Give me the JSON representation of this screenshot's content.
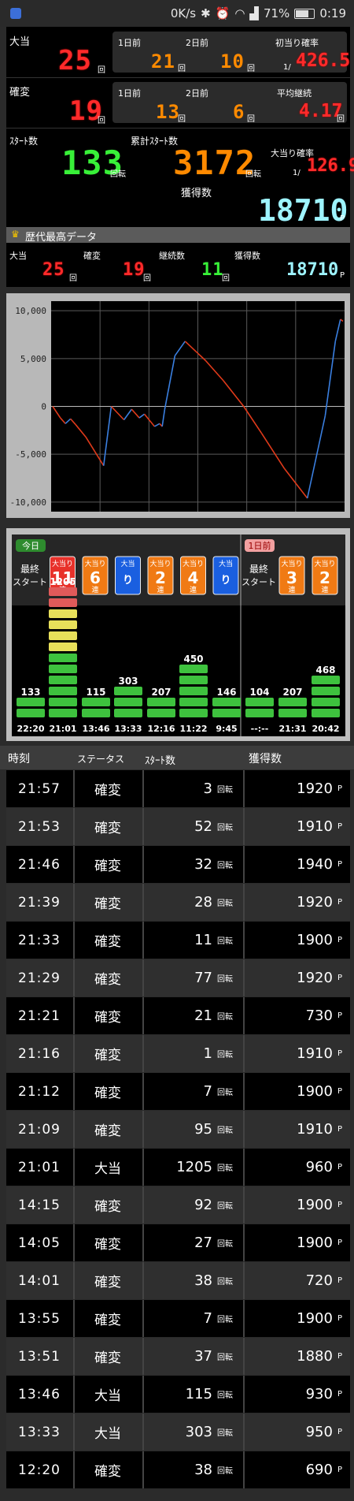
{
  "status": {
    "speed": "0K/s",
    "battery": "71%",
    "time": "0:19"
  },
  "summary": {
    "ootari": {
      "label": "大当",
      "value": "25",
      "unit": "回"
    },
    "prev1": {
      "label": "1日前",
      "value": "21",
      "unit": "回"
    },
    "prev2": {
      "label": "2日前",
      "value": "10",
      "unit": "回"
    },
    "first_prob": {
      "label": "初当り確率",
      "prefix": "1/",
      "value": "426.5"
    },
    "kakuhen": {
      "label": "確変",
      "value": "19",
      "unit": "回"
    },
    "k_prev1": {
      "label": "1日前",
      "value": "13",
      "unit": "回"
    },
    "k_prev2": {
      "label": "2日前",
      "value": "6",
      "unit": "回"
    },
    "avg_cont": {
      "label": "平均継続",
      "value": "4.17",
      "unit": "回"
    },
    "start": {
      "label": "ｽﾀｰﾄ数",
      "value": "133",
      "unit": "回転"
    },
    "total_start": {
      "label": "累計ｽﾀｰﾄ数",
      "value": "3172",
      "unit": "回転"
    },
    "ootari_prob": {
      "label": "大当り確率",
      "prefix": "1/",
      "value": "126.9"
    },
    "gain": {
      "label": "獲得数",
      "value": "18710",
      "unit": "P"
    }
  },
  "best": {
    "title": "歴代最高データ",
    "ootari": {
      "label": "大当",
      "value": "25",
      "unit": "回"
    },
    "kakuhen": {
      "label": "確変",
      "value": "19",
      "unit": "回"
    },
    "keizoku": {
      "label": "継続数",
      "value": "11",
      "unit": "回"
    },
    "gain": {
      "label": "獲得数",
      "value": "18710",
      "unit": "P"
    }
  },
  "chart_data": {
    "type": "line",
    "ylim": [
      -11000,
      11000
    ],
    "yticks": [
      "10,000",
      "5,000",
      "0",
      "-5,000",
      "-10,000"
    ],
    "ytick_values": [
      10000,
      5000,
      0,
      -5000,
      -10000
    ],
    "points": [
      [
        0,
        0
      ],
      [
        3,
        -1200
      ],
      [
        5,
        -1800
      ],
      [
        7,
        -1300
      ],
      [
        9,
        -1900
      ],
      [
        13,
        -3200
      ],
      [
        20,
        -6200
      ],
      [
        23,
        0
      ],
      [
        28,
        -1400
      ],
      [
        31,
        -300
      ],
      [
        34,
        -1200
      ],
      [
        36,
        -800
      ],
      [
        40,
        -2100
      ],
      [
        42,
        -1800
      ],
      [
        43,
        -2100
      ],
      [
        44,
        -300
      ],
      [
        48,
        5300
      ],
      [
        52,
        6800
      ],
      [
        60,
        4800
      ],
      [
        67,
        2700
      ],
      [
        75,
        0
      ],
      [
        82,
        -2800
      ],
      [
        91,
        -6500
      ],
      [
        100,
        -9600
      ],
      [
        107,
        -1000
      ],
      [
        111,
        6800
      ],
      [
        113,
        9100
      ],
      [
        114,
        8900
      ]
    ],
    "up_color": "#3a7fe0",
    "down_color": "#e03a1a",
    "grid": true
  },
  "today_badge": "今日",
  "prev_badge": "1日前",
  "hits_today": [
    {
      "label": "最終\nスタート",
      "type": "start"
    },
    {
      "top": "大当り",
      "num": "11",
      "bottom": "連",
      "color": "#e8312a"
    },
    {
      "top": "大当り",
      "num": "6",
      "bottom": "連",
      "color": "#f07a14"
    },
    {
      "top": "大当",
      "num": "り",
      "bottom": "",
      "color": "#1a5fe0"
    },
    {
      "top": "大当り",
      "num": "2",
      "bottom": "連",
      "color": "#f07a14"
    },
    {
      "top": "大当り",
      "num": "4",
      "bottom": "連",
      "color": "#f07a14"
    },
    {
      "top": "大当",
      "num": "り",
      "bottom": "",
      "color": "#1a5fe0"
    }
  ],
  "hits_prev": [
    {
      "label": "最終\nスタート",
      "type": "start"
    },
    {
      "top": "大当り",
      "num": "3",
      "bottom": "連",
      "color": "#f07a14"
    },
    {
      "top": "大当り",
      "num": "2",
      "bottom": "連",
      "color": "#f07a14"
    }
  ],
  "bars": [
    {
      "value": "133",
      "time": "22:20",
      "green": 2,
      "yellow": 0,
      "red": 0
    },
    {
      "value": "1205",
      "time": "21:01",
      "green": 6,
      "yellow": 4,
      "red": 2
    },
    {
      "value": "115",
      "time": "13:46",
      "green": 2,
      "yellow": 0,
      "red": 0
    },
    {
      "value": "303",
      "time": "13:33",
      "green": 3,
      "yellow": 0,
      "red": 0
    },
    {
      "value": "207",
      "time": "12:16",
      "green": 2,
      "yellow": 0,
      "red": 0
    },
    {
      "value": "450",
      "time": "11:22",
      "green": 5,
      "yellow": 0,
      "red": 0
    },
    {
      "value": "146",
      "time": "9:45",
      "green": 2,
      "yellow": 0,
      "red": 0
    },
    {
      "value": "104",
      "time": "--:--",
      "green": 2,
      "yellow": 0,
      "red": 0
    },
    {
      "value": "207",
      "time": "21:31",
      "green": 2,
      "yellow": 0,
      "red": 0
    },
    {
      "value": "468",
      "time": "20:42",
      "green": 4,
      "yellow": 0,
      "red": 0
    }
  ],
  "table": {
    "headers": [
      "時刻",
      "ステータス",
      "ｽﾀｰﾄ数",
      "獲得数"
    ],
    "spin_unit": "回転",
    "pt_unit": "P",
    "rows": [
      [
        "21:57",
        "確変",
        "3",
        "1920"
      ],
      [
        "21:53",
        "確変",
        "52",
        "1910"
      ],
      [
        "21:46",
        "確変",
        "32",
        "1940"
      ],
      [
        "21:39",
        "確変",
        "28",
        "1920"
      ],
      [
        "21:33",
        "確変",
        "11",
        "1900"
      ],
      [
        "21:29",
        "確変",
        "77",
        "1920"
      ],
      [
        "21:21",
        "確変",
        "21",
        "730"
      ],
      [
        "21:16",
        "確変",
        "1",
        "1910"
      ],
      [
        "21:12",
        "確変",
        "7",
        "1900"
      ],
      [
        "21:09",
        "確変",
        "95",
        "1910"
      ],
      [
        "21:01",
        "大当",
        "1205",
        "960"
      ],
      [
        "14:15",
        "確変",
        "92",
        "1900"
      ],
      [
        "14:05",
        "確変",
        "27",
        "1900"
      ],
      [
        "14:01",
        "確変",
        "38",
        "720"
      ],
      [
        "13:55",
        "確変",
        "7",
        "1900"
      ],
      [
        "13:51",
        "確変",
        "37",
        "1880"
      ],
      [
        "13:46",
        "大当",
        "115",
        "930"
      ],
      [
        "13:33",
        "大当",
        "303",
        "950"
      ],
      [
        "12:20",
        "確変",
        "38",
        "690"
      ]
    ]
  }
}
